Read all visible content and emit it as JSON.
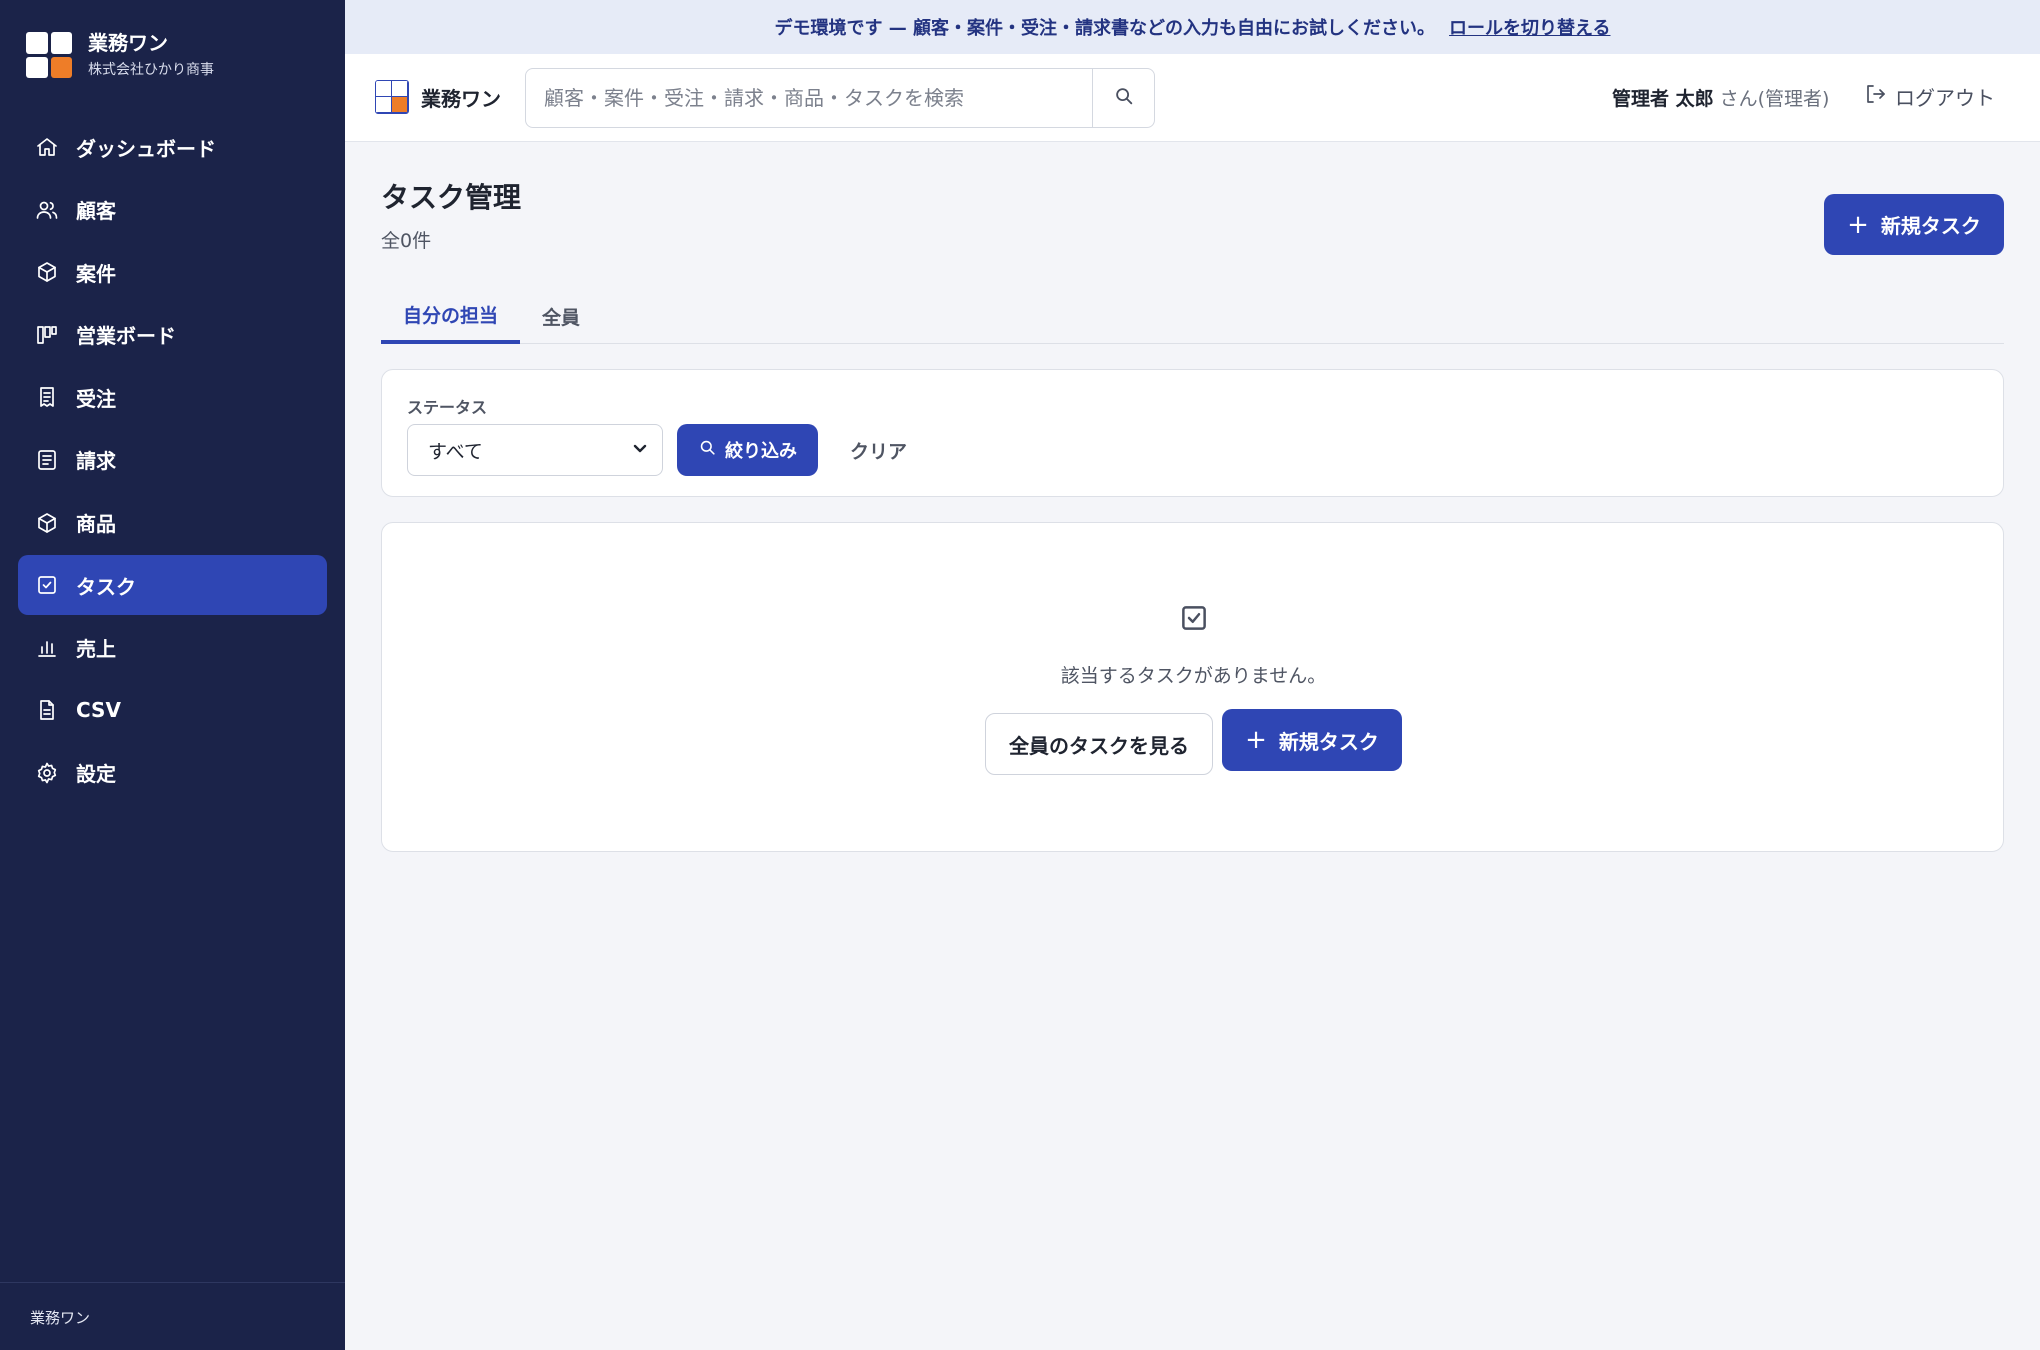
{
  "sidebar": {
    "brand_name": "業務ワン",
    "company": "株式会社ひかり商事",
    "items": [
      {
        "label": "ダッシュボード",
        "icon": "home-icon",
        "active": false
      },
      {
        "label": "顧客",
        "icon": "users-icon",
        "active": false
      },
      {
        "label": "案件",
        "icon": "box-icon",
        "active": false
      },
      {
        "label": "営業ボード",
        "icon": "kanban-icon",
        "active": false
      },
      {
        "label": "受注",
        "icon": "receipt-icon",
        "active": false
      },
      {
        "label": "請求",
        "icon": "document-icon",
        "active": false
      },
      {
        "label": "商品",
        "icon": "package-icon",
        "active": false
      },
      {
        "label": "タスク",
        "icon": "checkbox-icon",
        "active": true
      },
      {
        "label": "売上",
        "icon": "bar-chart-icon",
        "active": false
      },
      {
        "label": "CSV",
        "icon": "file-icon",
        "active": false
      },
      {
        "label": "設定",
        "icon": "gear-icon",
        "active": false
      }
    ],
    "footer": "業務ワン"
  },
  "banner": {
    "text": "デモ環境です — 顧客・案件・受注・請求書などの入力も自由にお試しください。",
    "link": "ロールを切り替える"
  },
  "header": {
    "brand_name": "業務ワン",
    "search_placeholder": "顧客・案件・受注・請求・商品・タスクを検索",
    "search_value": "",
    "user_name": "管理者 太郎",
    "user_role": "さん(管理者)",
    "logout_label": "ログアウト"
  },
  "main": {
    "title": "タスク管理",
    "count": "全0件",
    "new_task_label": "新規タスク",
    "tabs": [
      {
        "label": "自分の担当",
        "active": true
      },
      {
        "label": "全員",
        "active": false
      }
    ],
    "filter": {
      "status_label": "ステータス",
      "status_value": "すべて",
      "filter_button": "絞り込み",
      "clear_button": "クリア"
    },
    "empty": {
      "message": "該当するタスクがありません。",
      "see_all_button": "全員のタスクを見る",
      "new_task_button": "新規タスク"
    }
  },
  "colors": {
    "sidebar_bg": "#1b2349",
    "accent": "#2f46b4",
    "logo_orange": "#ee7d28",
    "banner_bg": "#e6ebf7",
    "page_bg": "#f4f5f9"
  }
}
